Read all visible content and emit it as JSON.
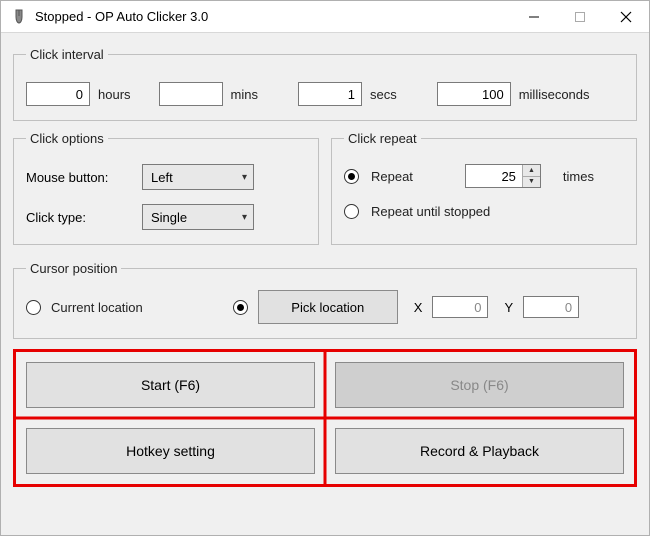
{
  "window": {
    "title": "Stopped - OP Auto Clicker 3.0"
  },
  "interval": {
    "legend": "Click interval",
    "hours": "0",
    "hours_label": "hours",
    "mins": "",
    "mins_label": "mins",
    "secs": "1",
    "secs_label": "secs",
    "ms": "100",
    "ms_label": "milliseconds"
  },
  "options": {
    "legend": "Click options",
    "mouse_label": "Mouse button:",
    "mouse_value": "Left",
    "type_label": "Click type:",
    "type_value": "Single"
  },
  "repeat": {
    "legend": "Click repeat",
    "repeat_label": "Repeat",
    "count": "25",
    "times_label": "times",
    "until_label": "Repeat until stopped"
  },
  "cursor": {
    "legend": "Cursor position",
    "current_label": "Current location",
    "pick_label": "Pick location",
    "x_label": "X",
    "x_value": "0",
    "y_label": "Y",
    "y_value": "0"
  },
  "footer": {
    "start": "Start (F6)",
    "stop": "Stop (F6)",
    "hotkey": "Hotkey setting",
    "record": "Record & Playback"
  }
}
